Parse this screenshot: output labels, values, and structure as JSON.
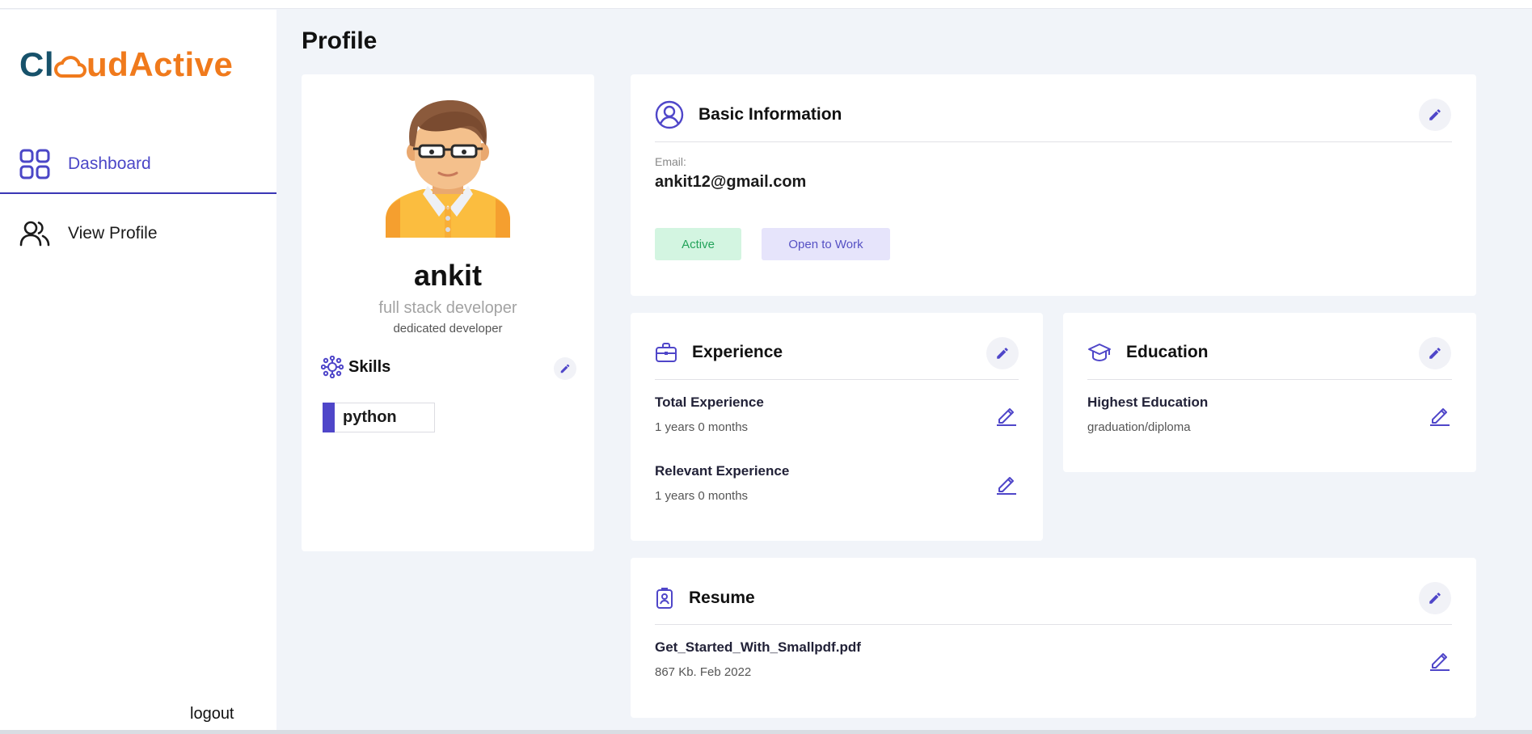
{
  "brand": {
    "logo_left": "Cl",
    "logo_mid": "ud",
    "logo_right": "Active",
    "primary_color": "#17526b",
    "accent_color": "#f07a1c"
  },
  "sidebar": {
    "items": [
      {
        "label": "Dashboard",
        "icon": "dashboard-grid-icon",
        "active": true
      },
      {
        "label": "View Profile",
        "icon": "users-icon",
        "active": false
      }
    ],
    "logout_label": "logout"
  },
  "page": {
    "title": "Profile"
  },
  "profile": {
    "name": "ankit",
    "role": "full stack developer",
    "bio": "dedicated developer",
    "skills_title": "Skills",
    "skills": [
      "python"
    ]
  },
  "basic": {
    "title": "Basic Information",
    "email_label": "Email:",
    "email_value": "ankit12@gmail.com",
    "status_badge": "Active",
    "work_badge": "Open to Work"
  },
  "experience": {
    "title": "Experience",
    "total_label": "Total Experience",
    "total_value": "1 years 0 months",
    "relevant_label": "Relevant Experience",
    "relevant_value": "1 years 0 months"
  },
  "education": {
    "title": "Education",
    "highest_label": "Highest Education",
    "highest_value": "graduation/diploma"
  },
  "resume": {
    "title": "Resume",
    "file_name": "Get_Started_With_Smallpdf.pdf",
    "file_meta": "867 Kb. Feb 2022"
  },
  "colors": {
    "accent": "#4f46c9",
    "active_badge_bg": "#d3f5e1",
    "active_badge_text": "#23a35a",
    "work_badge_bg": "#e6e4fb",
    "work_badge_text": "#5651c4",
    "page_bg": "#f1f4f9"
  }
}
